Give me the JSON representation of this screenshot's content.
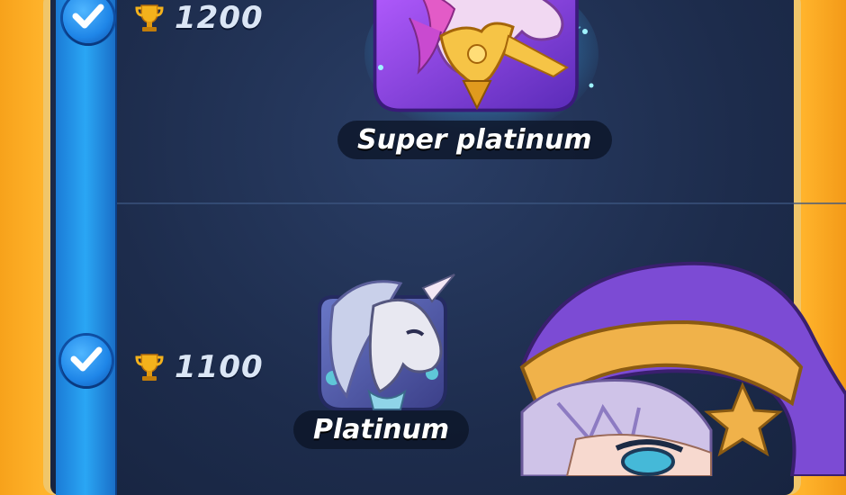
{
  "milestones": [
    {
      "trophies": "1200",
      "tier": "Super platinum",
      "reached": true
    },
    {
      "trophies": "1100",
      "tier": "Platinum",
      "reached": true
    }
  ],
  "icons": {
    "check": "checkmark-icon",
    "trophy": "trophy-icon",
    "super_platinum_badge": "unicorn-badge-super-platinum",
    "platinum_badge": "unicorn-badge-platinum",
    "mascot": "wizard-hat-character"
  },
  "colors": {
    "background_orange": "#ffb32b",
    "panel_navy": "#1d2c4c",
    "progress_blue": "#2aa6f4",
    "trophy_gold": "#f4b21c",
    "hat_purple": "#7c4bd4"
  }
}
